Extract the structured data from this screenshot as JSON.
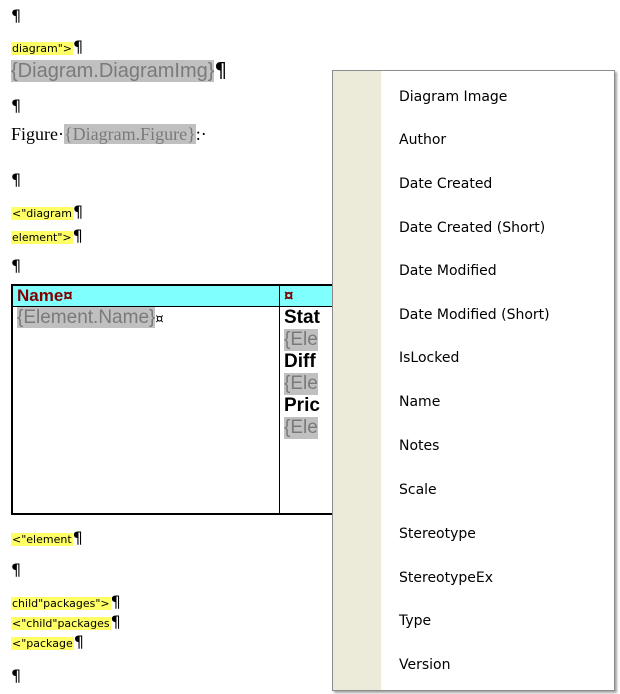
{
  "document": {
    "pilcrow": "¶",
    "diagram_open_tag": "diagram\">",
    "diagram_img_field": "{Diagram.DiagramImg}",
    "figure_label": "Figure·",
    "figure_field": "{Diagram.Figure}",
    "figure_tail": ":·",
    "diagram_element_tag_1": "<\"diagram",
    "diagram_element_tag_2": "element\">",
    "table": {
      "header_name": "Name¤",
      "header_col2": "¤",
      "element_name_field": "{Element.Name}",
      "cell_mark": "¤",
      "col2_lines": [
        {
          "text": "Stat",
          "style": "bold"
        },
        {
          "text": "{Ele",
          "style": "field"
        },
        {
          "text": "Diff",
          "style": "bold"
        },
        {
          "text": "{Ele",
          "style": "field"
        },
        {
          "text": "Pric",
          "style": "bold"
        },
        {
          "text": "{Ele",
          "style": "field"
        }
      ]
    },
    "element_close_tag": "<\"element",
    "child_packages_open": "child\"packages\">",
    "child_packages_close": "<\"child\"packages",
    "package_close": "<\"package"
  },
  "context_menu": {
    "items": [
      "Diagram Image",
      "Author",
      "Date Created",
      "Date Created (Short)",
      "Date Modified",
      "Date Modified (Short)",
      "IsLocked",
      "Name",
      "Notes",
      "Scale",
      "Stereotype",
      "StereotypeEx",
      "Type",
      "Version"
    ]
  }
}
